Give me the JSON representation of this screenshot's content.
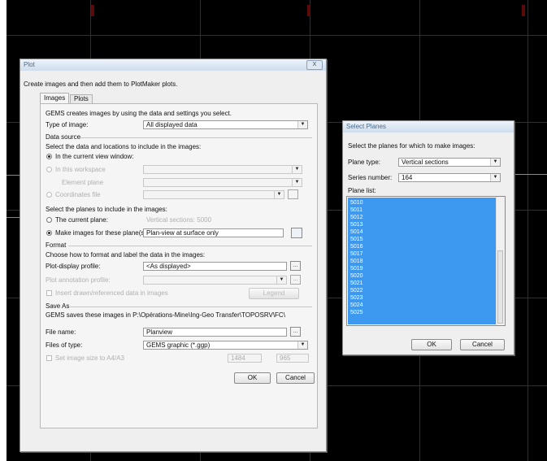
{
  "plot": {
    "title": "Plot",
    "close_label": "X",
    "intro": "Create images and then add them to PlotMaker plots.",
    "tabs": [
      {
        "label": "Images"
      },
      {
        "label": "Plots"
      }
    ],
    "gems_creates": "GEMS creates images by using the data and settings you select.",
    "type_of_image": {
      "label": "Type of image:",
      "value": "All displayed data"
    },
    "data_source": {
      "header": "Data source",
      "instruction": "Select the data and locations to include in the images:",
      "option_current_view": "In the current view window:",
      "option_2": "In this workspace",
      "option_2_sub": "Element plane",
      "option_3": "Coordinates file"
    },
    "planes": {
      "instruction": "Select the planes to include in the images:",
      "current_plane_label": "The current plane:",
      "current_plane_value": "Vertical sections: 5000",
      "make_images_label": "Make images for these plane(s):",
      "make_images_value": "Plan-view at surface only"
    },
    "format": {
      "header": "Format",
      "instruction": "Choose how to format and label the data in the images:",
      "profile_label": "Plot-display profile:",
      "profile_value": "<As displayed>",
      "dim_label": "Plot annotation profile:",
      "checkbox_label": "Insert drawn/referenced data in images",
      "legend_button": "Legend"
    },
    "save_as": {
      "header": "Save As",
      "path_text": "GEMS saves these images in P:\\Opérations-Mine\\Ing-Geo Transfer\\TOPOSRV\\FC\\",
      "file_name_label": "File name:",
      "file_name_value": "Planview",
      "files_of_type_label": "Files of type:",
      "files_of_type_value": "GEMS graphic (*.ggp)",
      "size_checkbox_label": "Set image size to A4/A3",
      "width": "1484",
      "height": "965"
    },
    "ok_label": "OK",
    "cancel_label": "Cancel",
    "browse_label": "...",
    "dropdown_glyph": "▼"
  },
  "select_planes": {
    "title": "Select Planes",
    "instruction": "Select the planes for which to make images:",
    "plane_type_label": "Plane type:",
    "plane_type_value": "Vertical sections",
    "series_label": "Series number:",
    "series_value": "164",
    "plane_list_label": "Plane list:",
    "planes": [
      "5010",
      "5011",
      "5012",
      "5013",
      "5014",
      "5015",
      "5016",
      "5017",
      "5018",
      "5019",
      "5020",
      "5021",
      "5022",
      "5023",
      "5024",
      "5025"
    ],
    "ok_label": "OK",
    "cancel_label": "Cancel"
  }
}
